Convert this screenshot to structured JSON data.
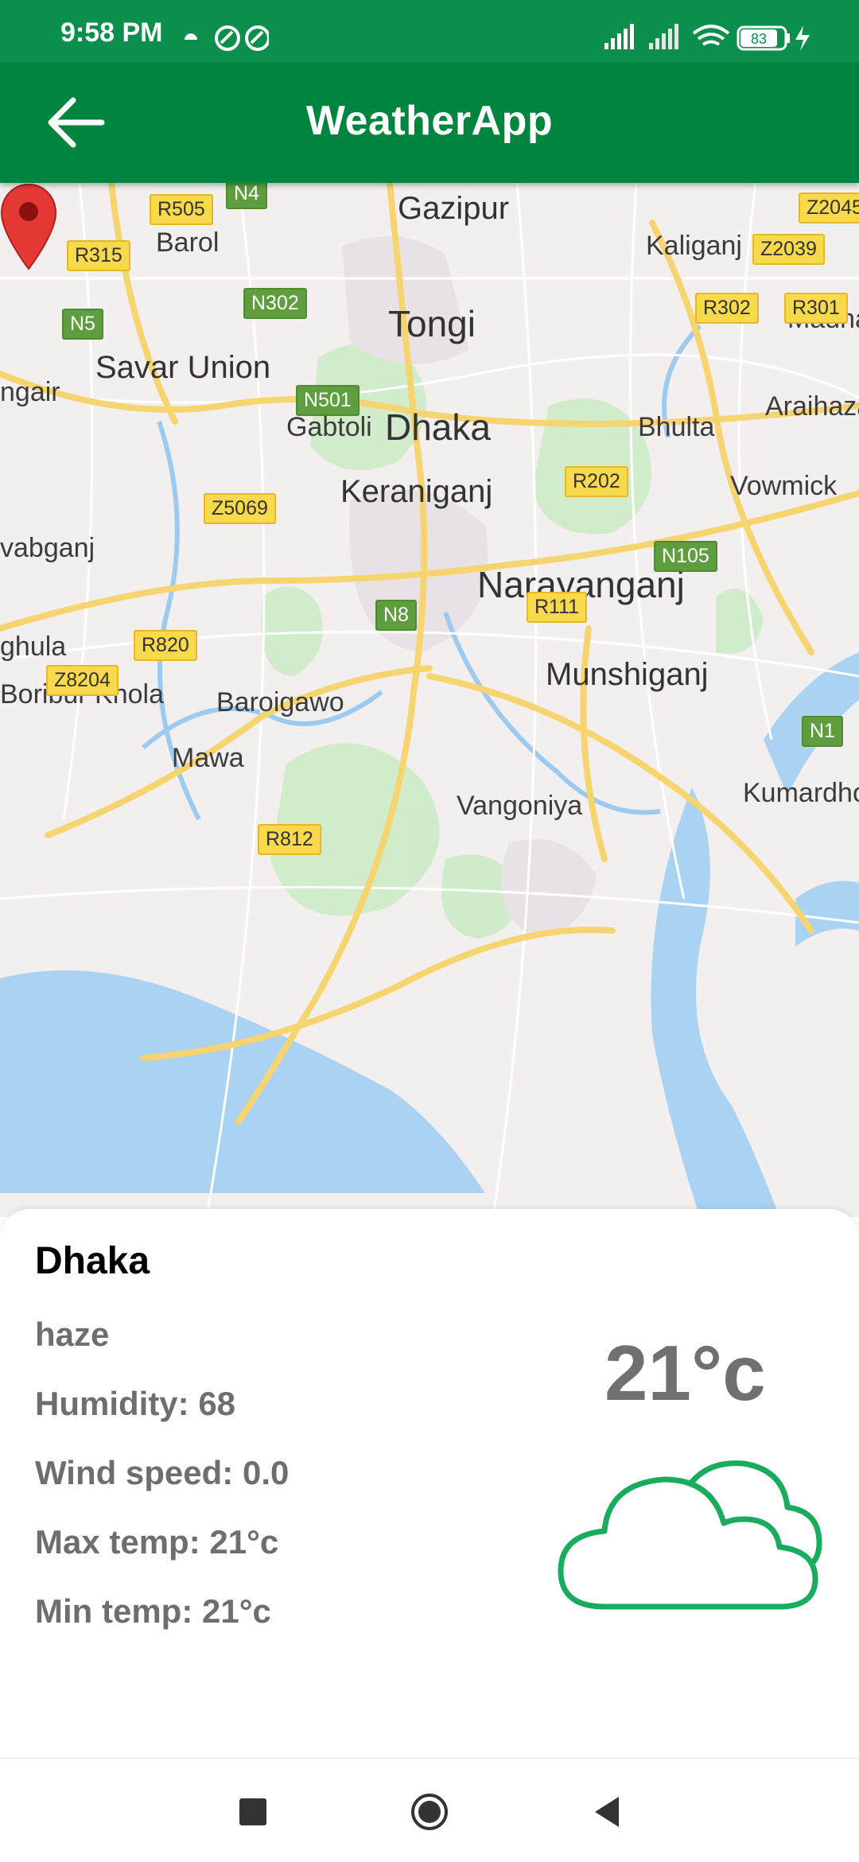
{
  "status_bar": {
    "time": "9:58 PM",
    "battery": "83"
  },
  "app_bar": {
    "title": "WeatherApp"
  },
  "map": {
    "places": [
      {
        "id": "gazipur",
        "text": "Gazipur"
      },
      {
        "id": "barol",
        "text": "Barol"
      },
      {
        "id": "kaliganj",
        "text": "Kaliganj"
      },
      {
        "id": "tongi",
        "text": "Tongi"
      },
      {
        "id": "savar",
        "text": "Savar Union"
      },
      {
        "id": "madha",
        "text": "Madha"
      },
      {
        "id": "dhaka",
        "text": "Dhaka"
      },
      {
        "id": "ngair",
        "text": "ngair"
      },
      {
        "id": "gabtoli",
        "text": "Gabtoli"
      },
      {
        "id": "bhulta",
        "text": "Bhulta"
      },
      {
        "id": "araihaza",
        "text": "Araihaza"
      },
      {
        "id": "vowmick",
        "text": "Vowmick"
      },
      {
        "id": "keraniganj",
        "text": "Keraniganj"
      },
      {
        "id": "vabganj",
        "text": "vabganj"
      },
      {
        "id": "narayanganj",
        "text": "Narayanganj"
      },
      {
        "id": "ghula",
        "text": "ghula"
      },
      {
        "id": "munshiganj",
        "text": "Munshiganj"
      },
      {
        "id": "boribur",
        "text": "Boribur Khola"
      },
      {
        "id": "baroigawo",
        "text": "Baroigawo"
      },
      {
        "id": "mawa",
        "text": "Mawa"
      },
      {
        "id": "vangoniya",
        "text": "Vangoniya"
      },
      {
        "id": "kumardho",
        "text": "Kumardho"
      }
    ],
    "roads": [
      {
        "id": "n4",
        "text": "N4",
        "type": "green"
      },
      {
        "id": "r505",
        "text": "R505",
        "type": "yellow"
      },
      {
        "id": "z2045",
        "text": "Z2045",
        "type": "yellow"
      },
      {
        "id": "r315",
        "text": "R315",
        "type": "yellow"
      },
      {
        "id": "z2039",
        "text": "Z2039",
        "type": "yellow"
      },
      {
        "id": "n302",
        "text": "N302",
        "type": "green"
      },
      {
        "id": "r302",
        "text": "R302",
        "type": "yellow"
      },
      {
        "id": "r301",
        "text": "R301",
        "type": "yellow"
      },
      {
        "id": "n5",
        "text": "N5",
        "type": "green"
      },
      {
        "id": "n501",
        "text": "N501",
        "type": "green"
      },
      {
        "id": "r202",
        "text": "R202",
        "type": "yellow"
      },
      {
        "id": "z5069",
        "text": "Z5069",
        "type": "yellow"
      },
      {
        "id": "n105",
        "text": "N105",
        "type": "green"
      },
      {
        "id": "r111",
        "text": "R111",
        "type": "yellow"
      },
      {
        "id": "n8",
        "text": "N8",
        "type": "green"
      },
      {
        "id": "r820",
        "text": "R820",
        "type": "yellow"
      },
      {
        "id": "z8204",
        "text": "Z8204",
        "type": "yellow"
      },
      {
        "id": "n1",
        "text": "N1",
        "type": "green"
      },
      {
        "id": "r812",
        "text": "R812",
        "type": "yellow"
      }
    ]
  },
  "weather": {
    "city": "Dhaka",
    "description": "haze",
    "humidity": "Humidity: 68",
    "wind_speed": "Wind speed: 0.0",
    "max_temp": "Max temp: 21°c",
    "min_temp": "Min temp: 21°c",
    "temperature": "21°c",
    "icon": "cloud-icon",
    "icon_color": "#1aac5e"
  },
  "colors": {
    "status_bar": "#0b8f4d",
    "app_bar": "#00853f",
    "marker": "#e53935"
  }
}
